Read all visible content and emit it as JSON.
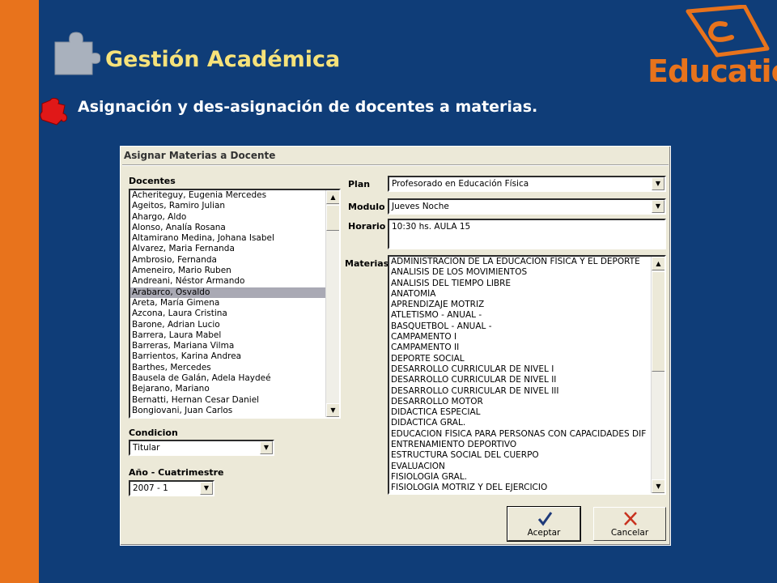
{
  "slide": {
    "title": "Gestión Académica",
    "subtitle": "Asignación y des-asignación de docentes a materias.",
    "logo_text": "Educatio",
    "logo_mark": "®"
  },
  "dialog": {
    "title": "Asignar Materias a Docente",
    "docentes": {
      "label": "Docentes",
      "selected": "Arabarco, Osvaldo",
      "items": [
        "Acheriteguy, Eugenia Mercedes",
        "Ageitos, Ramiro Julian",
        "Ahargo, Aldo",
        "Alonso, Analía Rosana",
        "Altamirano Medina, Johana Isabel",
        "Alvarez, Maria Fernanda",
        "Ambrosio, Fernanda",
        "Ameneiro, Mario Ruben",
        "Andreani, Néstor Armando",
        "Arabarco, Osvaldo",
        "Areta, María Gimena",
        "Azcona, Laura Cristina",
        "Barone, Adrian Lucio",
        "Barrera, Laura Mabel",
        "Barreras, Mariana Vilma",
        "Barrientos, Karina Andrea",
        "Barthes, Mercedes",
        "Bausela de Galán, Adela Haydeé",
        "Bejarano, Mariano",
        "Bernatti, Hernan Cesar Daniel",
        "Bongiovani, Juan Carlos"
      ]
    },
    "condicion": {
      "label": "Condicion",
      "value": "Titular"
    },
    "anio": {
      "label": "Año - Cuatrimestre",
      "value": "2007 - 1"
    },
    "plan": {
      "label": "Plan",
      "value": "Profesorado en Educación Física"
    },
    "modulo": {
      "label": "Modulo",
      "value": "Jueves Noche"
    },
    "horario": {
      "label": "Horario",
      "value": "10:30 hs.  AULA 15"
    },
    "materias": {
      "label": "Materias",
      "items": [
        "ADMINISTRACIÓN DE LA EDUCACIÓN FÍSICA Y EL DEPORTE",
        "ANÁLISIS DE LOS MOVIMIENTOS",
        "ANÁLISIS DEL TIEMPO LIBRE",
        "ANATOMÍA",
        "APRENDIZAJE MOTRIZ",
        "ATLETISMO - ANUAL -",
        "BASQUETBOL - ANUAL -",
        "CAMPAMENTO I",
        "CAMPAMENTO II",
        "DEPORTE SOCIAL",
        "DESARROLLO CURRICULAR DE NIVEL I",
        "DESARROLLO CURRICULAR DE NIVEL II",
        "DESARROLLO CURRICULAR DE NIVEL III",
        "DESARROLLO MOTOR",
        "DIDÁCTICA ESPECIAL",
        "DIDÁCTICA GRAL.",
        "EDUCACIÓN FÍSICA PARA PERSONAS CON CAPACIDADES DIF",
        "ENTRENAMIENTO DEPORTIVO",
        "ESTRUCTURA SOCIAL DEL CUERPO",
        "EVALUACIÓN",
        "FISIOLOGÍA GRAL.",
        "FISIOLOGÍA MOTRIZ Y DEL EJERCICIO"
      ]
    },
    "buttons": {
      "accept": "Aceptar",
      "cancel": "Cancelar"
    },
    "icons": {
      "accept": "checkmark-icon",
      "cancel": "x-icon"
    },
    "colors": {
      "accept_icon": "#1e3a7a",
      "cancel_icon": "#c8321e"
    }
  },
  "colors": {
    "background": "#0f3d78",
    "side_bar": "#e8731c",
    "title": "#f6e27a",
    "subtitle": "#ffffff",
    "logo": "#e8731c"
  }
}
